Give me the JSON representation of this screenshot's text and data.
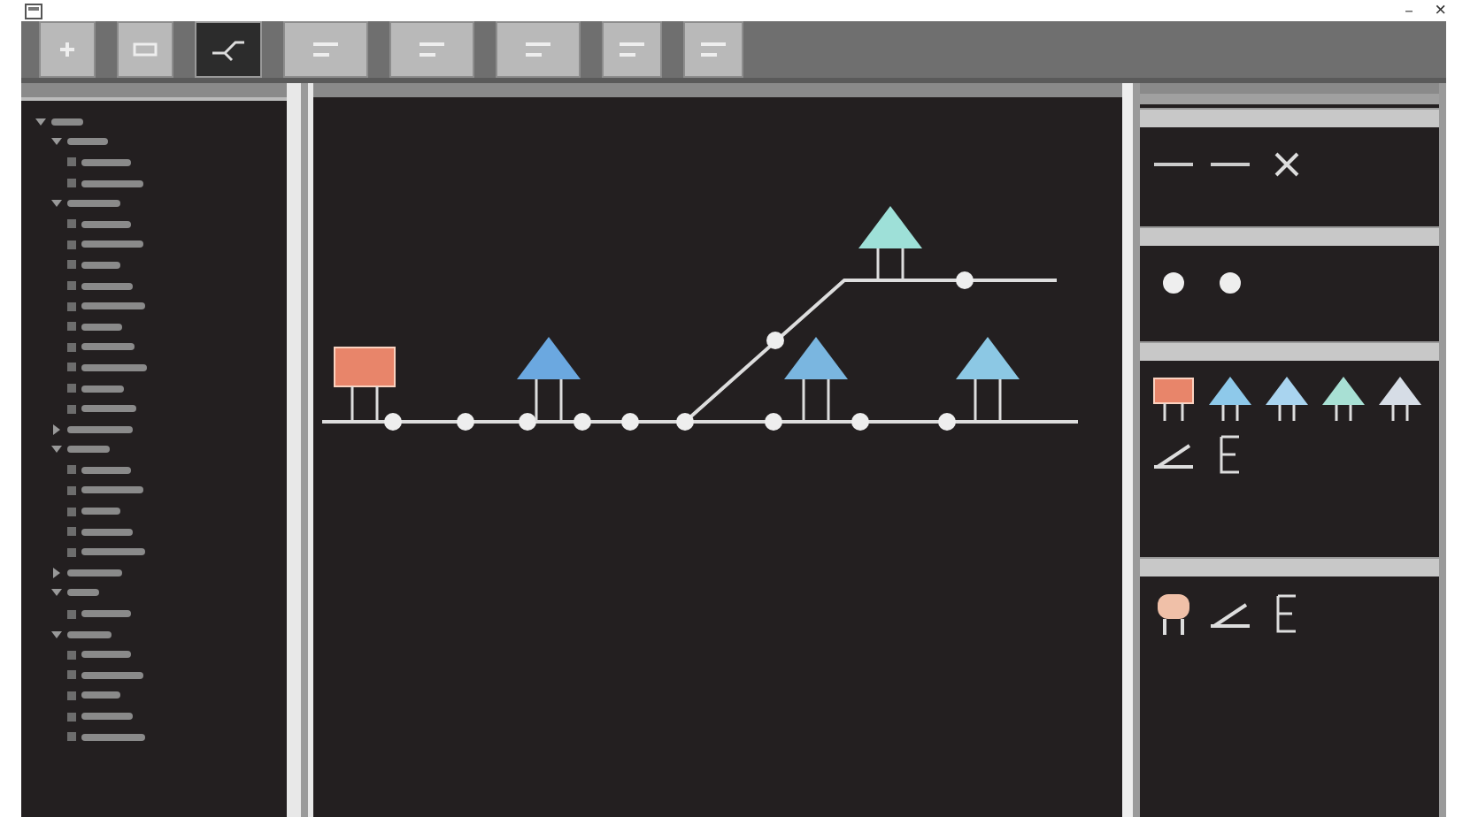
{
  "window": {
    "controls": [
      {
        "kind": "minimize",
        "glyph": "－"
      },
      {
        "kind": "close",
        "glyph": "×"
      }
    ]
  },
  "toolbar": [
    {
      "kind": "plus",
      "selected": false
    },
    {
      "kind": "minus",
      "selected": false
    },
    {
      "kind": "track",
      "selected": true
    },
    {
      "kind": "panel",
      "selected": false
    },
    {
      "kind": "panel",
      "selected": false
    },
    {
      "kind": "panel",
      "selected": false
    },
    {
      "kind": "small",
      "selected": false
    },
    {
      "kind": "small",
      "selected": false
    }
  ],
  "tree": [
    {
      "expanded": true,
      "children": [
        {
          "expanded": true,
          "children": [
            {
              "kind": "item"
            },
            {
              "kind": "item"
            }
          ]
        },
        {
          "expanded": true,
          "children": [
            {
              "kind": "item"
            },
            {
              "kind": "item"
            },
            {
              "kind": "item"
            },
            {
              "kind": "item"
            },
            {
              "kind": "item"
            },
            {
              "kind": "item"
            },
            {
              "kind": "item"
            },
            {
              "kind": "item"
            },
            {
              "kind": "item"
            },
            {
              "kind": "item"
            }
          ]
        },
        {
          "expanded": false
        },
        {
          "expanded": true,
          "children": [
            {
              "kind": "item"
            },
            {
              "kind": "item"
            },
            {
              "kind": "item"
            },
            {
              "kind": "item"
            },
            {
              "kind": "item"
            }
          ]
        },
        {
          "expanded": false
        },
        {
          "expanded": true,
          "children": [
            {
              "kind": "item"
            }
          ]
        },
        {
          "expanded": true,
          "children": [
            {
              "kind": "item"
            },
            {
              "kind": "item"
            },
            {
              "kind": "item"
            },
            {
              "kind": "item"
            },
            {
              "kind": "item"
            }
          ]
        }
      ]
    }
  ],
  "palette": [
    {
      "items": [
        {
          "kind": "line"
        },
        {
          "kind": "line"
        },
        {
          "kind": "cross"
        }
      ]
    },
    {
      "items": [
        {
          "kind": "dot"
        },
        {
          "kind": "dot"
        }
      ]
    },
    {
      "items": [
        {
          "kind": "sign"
        },
        {
          "kind": "triangle",
          "color": "#8ec9ea"
        },
        {
          "kind": "triangle",
          "color": "#a9d4ef"
        },
        {
          "kind": "triangle",
          "color": "#a8e0d4"
        },
        {
          "kind": "triangle",
          "color": "#d6dde6"
        },
        {
          "kind": "switch"
        },
        {
          "kind": "marker"
        }
      ]
    },
    {
      "items": [
        {
          "kind": "figure"
        },
        {
          "kind": "switch"
        },
        {
          "kind": "marker"
        }
      ]
    }
  ]
}
